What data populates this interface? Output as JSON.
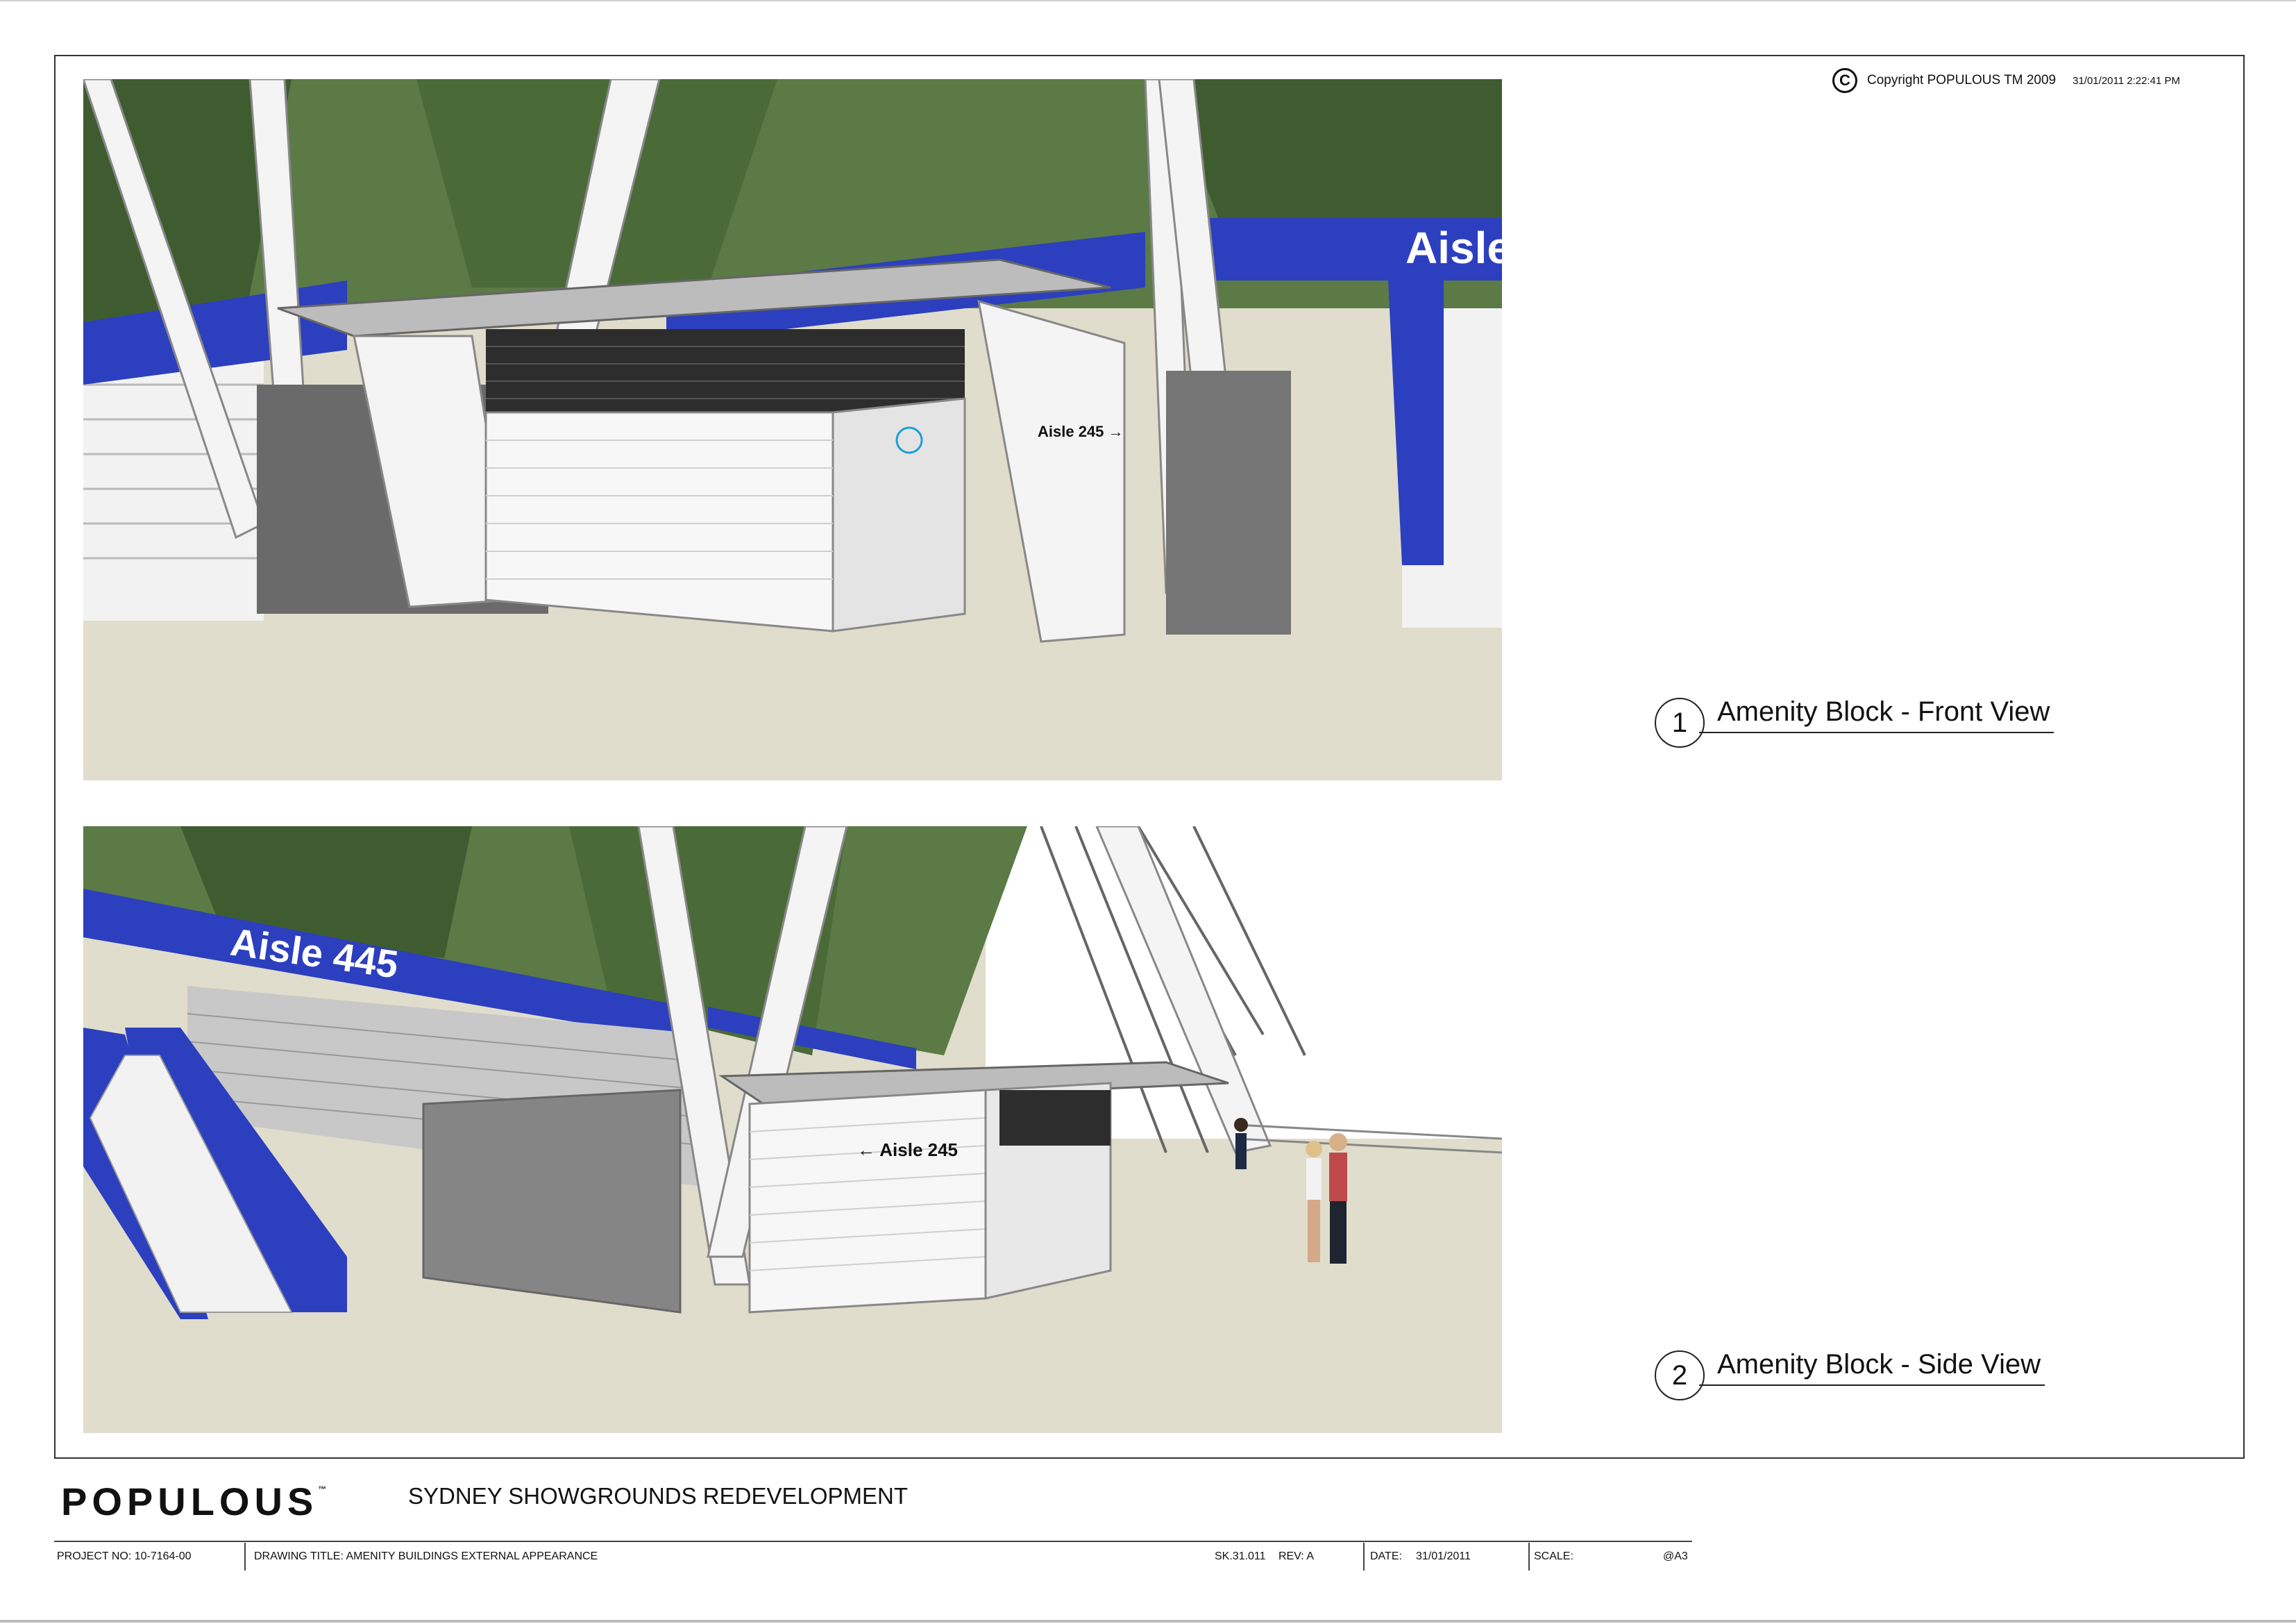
{
  "copyright": {
    "text": "Copyright  POPULOUS TM  2009",
    "timestamp": "31/01/2011 2:22:41 PM"
  },
  "views": [
    {
      "number": "1",
      "title": "Amenity Block - Front View",
      "signs": [
        "Aisle",
        "Aisle 245 →"
      ]
    },
    {
      "number": "2",
      "title": "Amenity Block - Side View",
      "signs": [
        "Aisle 445",
        "← Aisle 245"
      ]
    }
  ],
  "footer": {
    "logo": "POPULOUS",
    "logo_mark": "™",
    "project_title": "SYDNEY SHOWGROUNDS REDEVELOPMENT",
    "title_block": {
      "project_no": "PROJECT NO:  10-7164-00",
      "drawing_title": "DRAWING TITLE:  AMENITY BUILDINGS EXTERNAL APPEARANCE",
      "sheet": "SK.31.011",
      "rev": "REV:  A",
      "date_label": "DATE:",
      "date": "31/01/2011",
      "scale": "SCALE:",
      "paper": "@A3"
    }
  },
  "colors": {
    "accent_blue": "#2c3fbf",
    "ground": "#e2dfcf",
    "foliage": "#4f6d3c",
    "building_grey": "#8e8e8e"
  }
}
